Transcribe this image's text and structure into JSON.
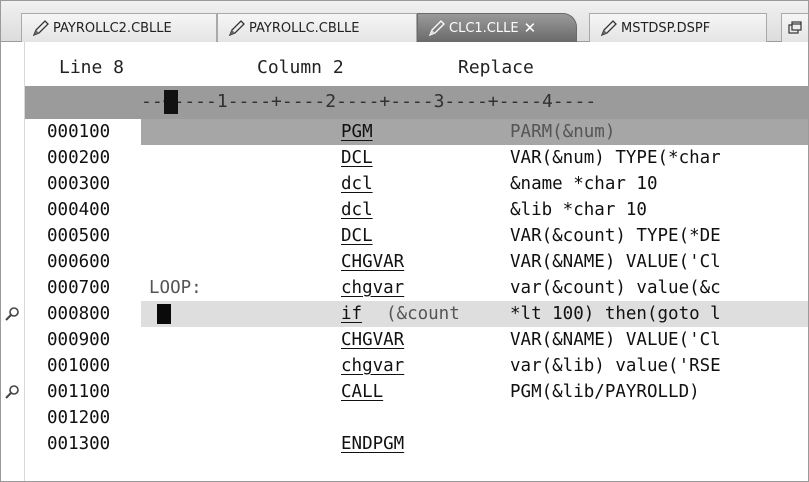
{
  "tabs": [
    {
      "label": "PAYROLLC2.CBLLE",
      "active": false
    },
    {
      "label": "PAYROLLC.CBLLE",
      "active": false
    },
    {
      "label": "CLC1.CLLE",
      "active": true
    },
    {
      "label": "MSTDSP.DSPF",
      "active": false
    }
  ],
  "tab_overflow_icon": "window-list-icon",
  "status": {
    "line": "Line 8",
    "column": "Column 2",
    "mode": "Replace"
  },
  "ruler": "--+----1----+----2----+----3----+----4----",
  "lines": [
    {
      "seq": "000100",
      "label": "",
      "keyword": "PGM",
      "args": "PARM(&num)"
    },
    {
      "seq": "000200",
      "label": "",
      "keyword": "DCL",
      "args": "VAR(&num) TYPE(*char"
    },
    {
      "seq": "000300",
      "label": "",
      "keyword": "dcl",
      "args": "&name *char 10"
    },
    {
      "seq": "000400",
      "label": "",
      "keyword": "dcl",
      "args": "&lib *char 10"
    },
    {
      "seq": "000500",
      "label": "",
      "keyword": "DCL",
      "args": "VAR(&count) TYPE(*DE"
    },
    {
      "seq": "000600",
      "label": "",
      "keyword": "CHGVAR",
      "args": "VAR(&NAME) VALUE('Cl"
    },
    {
      "seq": "000700",
      "label": "LOOP:",
      "keyword": "chgvar",
      "args": "var(&count) value(&c"
    },
    {
      "seq": "000800",
      "label": "",
      "keyword": "if",
      "args_inline": "(&count",
      "args_rest": "*lt 100) then(goto l"
    },
    {
      "seq": "000900",
      "label": "",
      "keyword": "CHGVAR",
      "args": "VAR(&NAME) VALUE('Cl"
    },
    {
      "seq": "001000",
      "label": "",
      "keyword": "chgvar",
      "args": "var(&lib) value('RSE"
    },
    {
      "seq": "001100",
      "label": "",
      "keyword": "CALL",
      "args": "PGM(&lib/PAYROLLD)"
    },
    {
      "seq": "001200",
      "label": "",
      "keyword": "",
      "args": ""
    },
    {
      "seq": "001300",
      "label": "",
      "keyword": "ENDPGM",
      "args": ""
    }
  ],
  "colors": {
    "ruler_bg": "#9b9b9b",
    "first_line_bg": "#a6a6a6",
    "current_line_bg": "#dedede",
    "active_tab": "#7a7a7a"
  }
}
